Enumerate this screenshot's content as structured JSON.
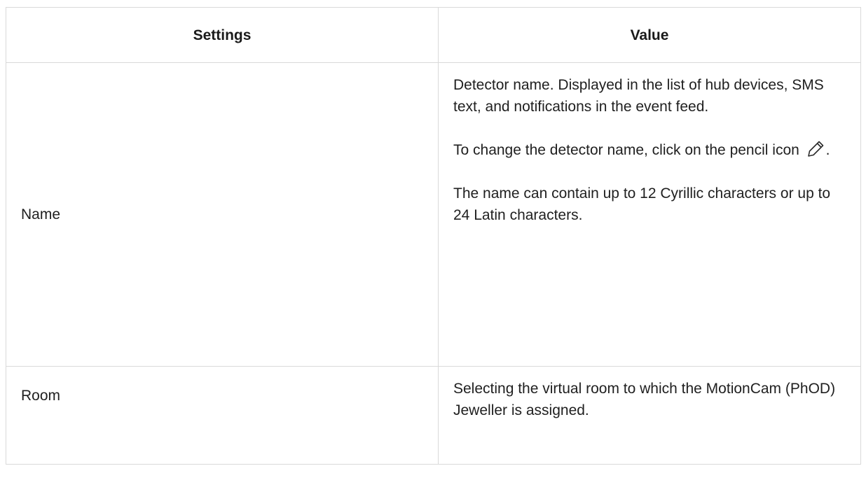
{
  "table": {
    "headers": {
      "setting": "Settings",
      "value": "Value"
    },
    "rows": [
      {
        "setting": "Name",
        "paragraphs": [
          "Detector name. Displayed in the list of hub devices, SMS text, and notifications in the event feed.",
          "To change the detector name, click on the pencil icon",
          "The name can contain up to 12 Cyrillic characters or up to 24 Latin characters."
        ],
        "icon_suffix": ".",
        "icon": "pencil-icon"
      },
      {
        "setting": "Room",
        "paragraphs": [
          "Selecting the virtual room to which the MotionCam (PhOD) Jeweller is assigned."
        ]
      }
    ]
  }
}
